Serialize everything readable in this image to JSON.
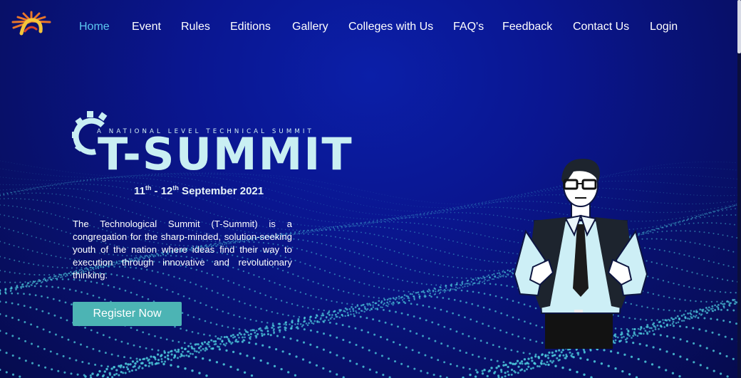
{
  "colors": {
    "accent": "#5cc7f0",
    "button": "#4cb4b4",
    "background": "#0a1690",
    "dots": "#4fd0e0"
  },
  "nav": {
    "logo_icon": "sun-logo-icon",
    "items": [
      {
        "label": "Home",
        "active": true
      },
      {
        "label": "Event",
        "active": false
      },
      {
        "label": "Rules",
        "active": false
      },
      {
        "label": "Editions",
        "active": false
      },
      {
        "label": "Gallery",
        "active": false
      },
      {
        "label": "Colleges with Us",
        "active": false
      },
      {
        "label": "FAQ's",
        "active": false
      },
      {
        "label": "Feedback",
        "active": false
      },
      {
        "label": "Contact Us",
        "active": false
      },
      {
        "label": "Login",
        "active": false
      }
    ]
  },
  "hero": {
    "tagline": "A NATIONAL LEVEL TECHNICAL SUMMIT",
    "title": "T-SUMMIT",
    "date_day1": "11",
    "date_sup1": "th",
    "date_sep": " - ",
    "date_day2": "12",
    "date_sup2": "th",
    "date_rest": " September 2021",
    "description": "The Technological Summit (T-Summit) is a congregation for the sharp-minded, solution-seeking youth of the nation where ideas find their way to execution through innovative and revolutionary thinking.",
    "register_label": "Register Now",
    "illustration_icon": "presenter-man-icon"
  }
}
